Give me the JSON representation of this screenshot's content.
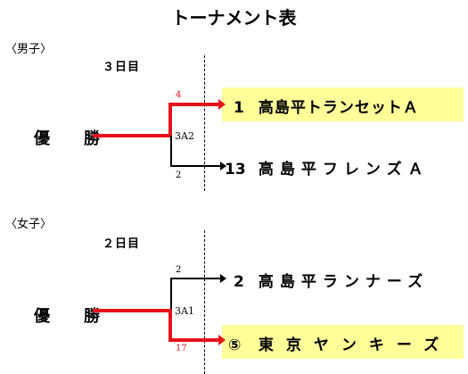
{
  "title": "トーナメント表",
  "sections": [
    {
      "label": "〈男子〉",
      "day": "３日目",
      "champion_label": "優　勝",
      "match_code": "3A2",
      "top": {
        "score": "4",
        "seed": "1",
        "name": "高島平トランセットＡ",
        "winner": true
      },
      "bottom": {
        "score": "2",
        "seed": "13",
        "name": "高島平フレンズＡ",
        "winner": false
      }
    },
    {
      "label": "〈女子〉",
      "day": "２日目",
      "champion_label": "優　勝",
      "match_code": "3A1",
      "top": {
        "score": "2",
        "seed": "2",
        "name": "高島平ランナーズ",
        "winner": false
      },
      "bottom": {
        "score": "17",
        "seed": "⑤",
        "name": "東京ヤンキーズ",
        "winner": true
      }
    }
  ],
  "colors": {
    "win_line": "#e6121b",
    "lose_line": "#000000",
    "highlight": "#ffff99"
  }
}
